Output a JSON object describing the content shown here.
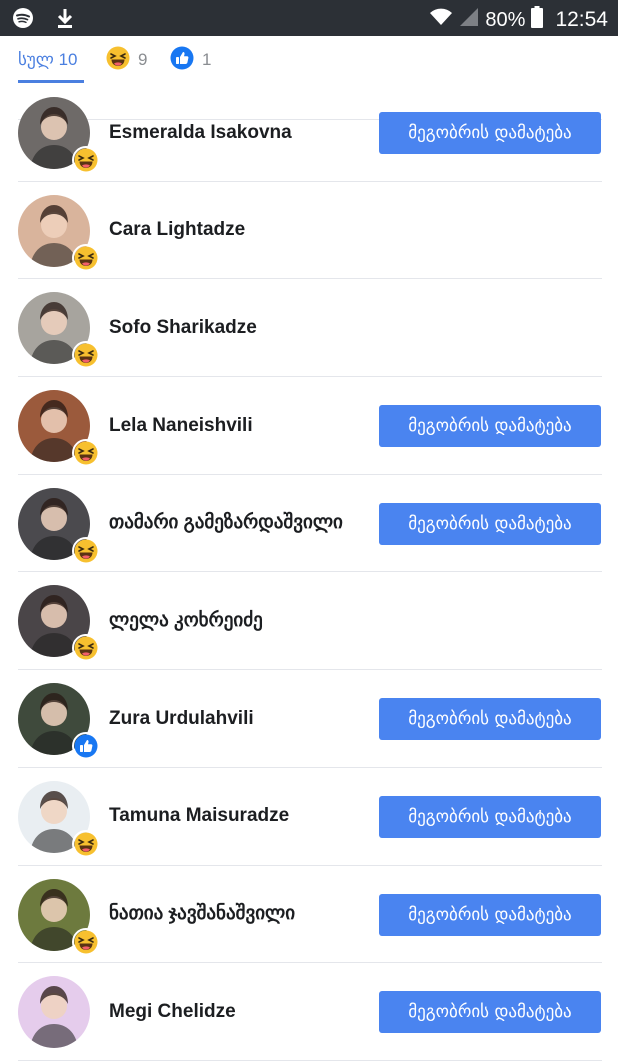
{
  "status_bar": {
    "battery": "80%",
    "time": "12:54",
    "icons": [
      "spotify-icon",
      "download-icon",
      "wifi-icon",
      "signal-icon",
      "battery-icon"
    ]
  },
  "tabs": [
    {
      "label": "სულ 10",
      "icon": "none"
    },
    {
      "label": "9",
      "icon": "haha-reaction-icon"
    },
    {
      "label": "1",
      "icon": "like-reaction-icon"
    }
  ],
  "add_friend_label": "მეგობრის დამატება",
  "colors": {
    "accent": "#4a7fe0",
    "button": "#4a84f0",
    "haha": "#f7c02f",
    "like": "#1877f2"
  },
  "people": [
    {
      "name": "Esmeralda Isakovna",
      "reaction": "haha",
      "show_add": true,
      "avatar_bg": "#6e6a68"
    },
    {
      "name": "Cara Lightadze",
      "reaction": "haha",
      "show_add": false,
      "avatar_bg": "#d9b49c"
    },
    {
      "name": "Sofo Sharikadze",
      "reaction": "haha",
      "show_add": false,
      "avatar_bg": "#a7a49e"
    },
    {
      "name": "Lela Naneishvili",
      "reaction": "haha",
      "show_add": true,
      "avatar_bg": "#9b5a3c"
    },
    {
      "name": "თამარი გამეზარდაშვილი",
      "reaction": "haha",
      "show_add": true,
      "avatar_bg": "#4b4a4e"
    },
    {
      "name": "ლელა კოხრეიძე",
      "reaction": "haha",
      "show_add": false,
      "avatar_bg": "#4a4548"
    },
    {
      "name": "Zura Urdulahvili",
      "reaction": "like",
      "show_add": true,
      "avatar_bg": "#3f4a3c"
    },
    {
      "name": "Tamuna Maisuradze",
      "reaction": "haha",
      "show_add": true,
      "avatar_bg": "#e9eef2"
    },
    {
      "name": "ნათია ჯავშანაშვილი",
      "reaction": "haha",
      "show_add": true,
      "avatar_bg": "#6d7a3e"
    },
    {
      "name": "Megi Chelidze",
      "reaction": "none",
      "show_add": true,
      "avatar_bg": "#e5ccec"
    }
  ]
}
